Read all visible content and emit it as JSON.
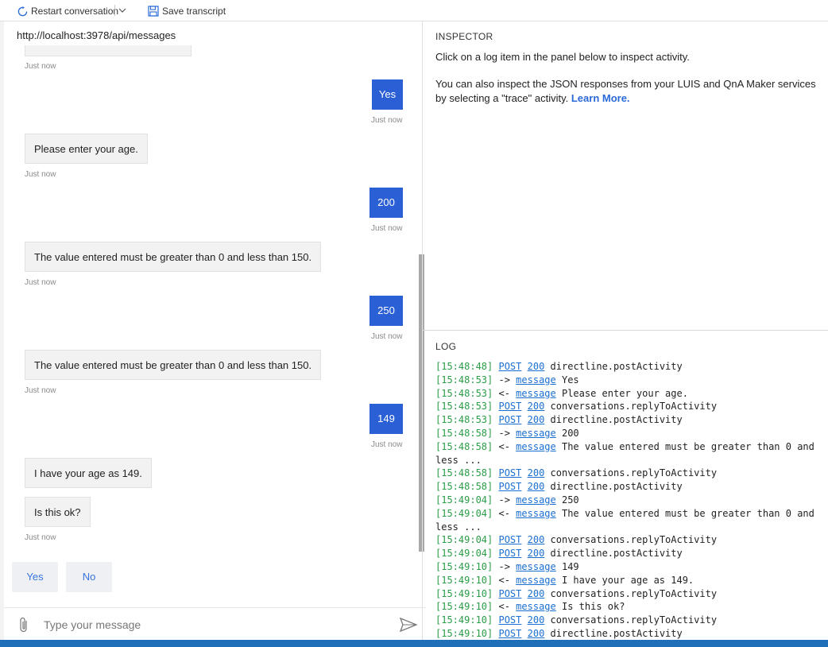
{
  "toolbar": {
    "restart_label": "Restart conversation",
    "save_label": "Save transcript"
  },
  "chat": {
    "url": "http://localhost:3978/api/messages",
    "timestamp_label": "Just now",
    "messages": [
      {
        "from": "user",
        "text": "Yes"
      },
      {
        "from": "bot",
        "text": "Please enter your age."
      },
      {
        "from": "user",
        "text": "200"
      },
      {
        "from": "bot",
        "text": "The value entered must be greater than 0 and less than 150."
      },
      {
        "from": "user",
        "text": "250"
      },
      {
        "from": "bot",
        "text": "The value entered must be greater than 0 and less than 150."
      },
      {
        "from": "user",
        "text": "149"
      },
      {
        "from": "bot",
        "text": "I have your age as 149."
      },
      {
        "from": "bot",
        "text": "Is this ok?"
      }
    ],
    "suggested_actions": [
      "Yes",
      "No"
    ],
    "input_placeholder": "Type your message"
  },
  "inspector": {
    "title": "INSPECTOR",
    "line1": "Click on a log item in the panel below to inspect activity.",
    "line2": "You can also inspect the JSON responses from your LUIS and QnA Maker services by selecting a \"trace\" activity.",
    "learn_more": "Learn More."
  },
  "log": {
    "title": "LOG",
    "entries": [
      {
        "time": "[15:48:48]",
        "a": "POST",
        "b": "200",
        "text": "directline.postActivity"
      },
      {
        "time": "[15:48:53]",
        "arrow": "->",
        "a": "message",
        "text": "Yes"
      },
      {
        "time": "[15:48:53]",
        "arrow": "<-",
        "a": "message",
        "text": "Please enter your age."
      },
      {
        "time": "[15:48:53]",
        "a": "POST",
        "b": "200",
        "text": "conversations.replyToActivity"
      },
      {
        "time": "[15:48:53]",
        "a": "POST",
        "b": "200",
        "text": "directline.postActivity"
      },
      {
        "time": "[15:48:58]",
        "arrow": "->",
        "a": "message",
        "text": "200"
      },
      {
        "time": "[15:48:58]",
        "arrow": "<-",
        "a": "message",
        "text": "The value entered must be greater than 0 and less ..."
      },
      {
        "time": "[15:48:58]",
        "a": "POST",
        "b": "200",
        "text": "conversations.replyToActivity"
      },
      {
        "time": "[15:48:58]",
        "a": "POST",
        "b": "200",
        "text": "directline.postActivity"
      },
      {
        "time": "[15:49:04]",
        "arrow": "->",
        "a": "message",
        "text": "250"
      },
      {
        "time": "[15:49:04]",
        "arrow": "<-",
        "a": "message",
        "text": "The value entered must be greater than 0 and less ..."
      },
      {
        "time": "[15:49:04]",
        "a": "POST",
        "b": "200",
        "text": "conversations.replyToActivity"
      },
      {
        "time": "[15:49:04]",
        "a": "POST",
        "b": "200",
        "text": "directline.postActivity"
      },
      {
        "time": "[15:49:10]",
        "arrow": "->",
        "a": "message",
        "text": "149"
      },
      {
        "time": "[15:49:10]",
        "arrow": "<-",
        "a": "message",
        "text": "I have your age as 149."
      },
      {
        "time": "[15:49:10]",
        "a": "POST",
        "b": "200",
        "text": "conversations.replyToActivity"
      },
      {
        "time": "[15:49:10]",
        "arrow": "<-",
        "a": "message",
        "text": "Is this ok?"
      },
      {
        "time": "[15:49:10]",
        "a": "POST",
        "b": "200",
        "text": "conversations.replyToActivity"
      },
      {
        "time": "[15:49:10]",
        "a": "POST",
        "b": "200",
        "text": "directline.postActivity"
      }
    ]
  },
  "colors": {
    "user_bubble": "#2a5fd6",
    "accent": "#3674e0",
    "timestamp": "#2a9d47",
    "statusbar": "#1f6fb8"
  }
}
